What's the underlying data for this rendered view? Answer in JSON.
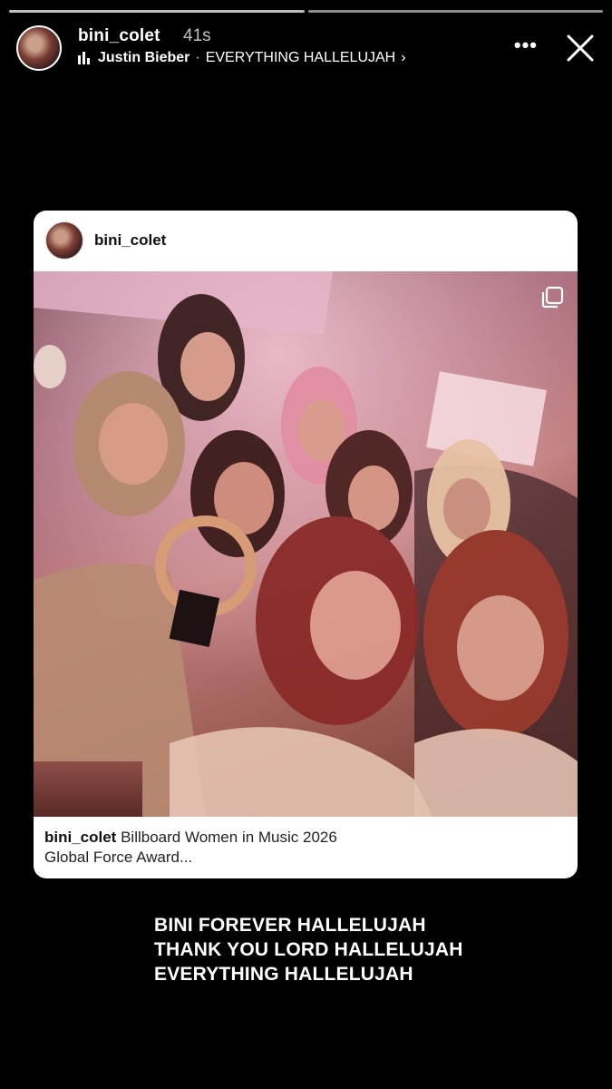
{
  "progress": {
    "segments": 2,
    "active_index": 0
  },
  "header": {
    "username": "bini_colet",
    "time": "41s",
    "music": {
      "artist": "Justin Bieber",
      "separator": "·",
      "song": "EVERYTHING HALLELUJAH",
      "chevron": "›"
    },
    "more_icon": "•••",
    "close_icon": "close-icon"
  },
  "post": {
    "username": "bini_colet",
    "caption_user": "bini_colet",
    "caption_line1": " Billboard Women in Music 2026",
    "caption_line2": "Global Force Award...",
    "multi_icon": "carousel-icon"
  },
  "story_text": [
    "BINI FOREVER HALLELUJAH",
    "THANK YOU LORD HALLELUJAH",
    "EVERYTHING HALLELUJAH"
  ]
}
